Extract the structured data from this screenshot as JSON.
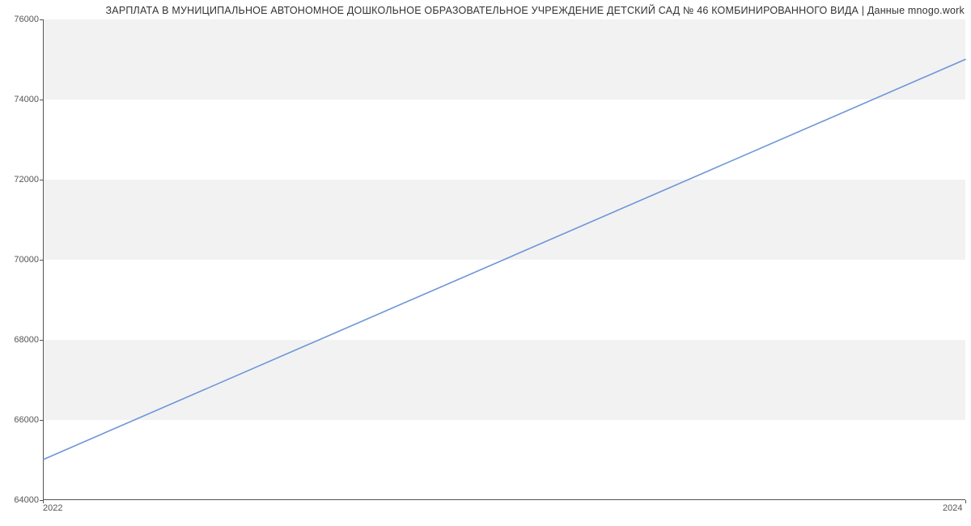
{
  "chart_data": {
    "type": "line",
    "title": "ЗАРПЛАТА В МУНИЦИПАЛЬНОЕ АВТОНОМНОЕ ДОШКОЛЬНОЕ ОБРАЗОВАТЕЛЬНОЕ УЧРЕЖДЕНИЕ ДЕТСКИЙ САД № 46 КОМБИНИРОВАННОГО ВИДА | Данные mnogo.work",
    "x": [
      2022,
      2024
    ],
    "values": [
      65000,
      75000
    ],
    "xlabel": "",
    "ylabel": "",
    "xlim": [
      2022,
      2024
    ],
    "ylim": [
      64000,
      76000
    ],
    "x_ticks": [
      2022,
      2024
    ],
    "y_ticks": [
      64000,
      66000,
      68000,
      70000,
      72000,
      74000,
      76000
    ],
    "line_color": "#6c96d9",
    "grid_band_color": "#f2f2f2"
  }
}
